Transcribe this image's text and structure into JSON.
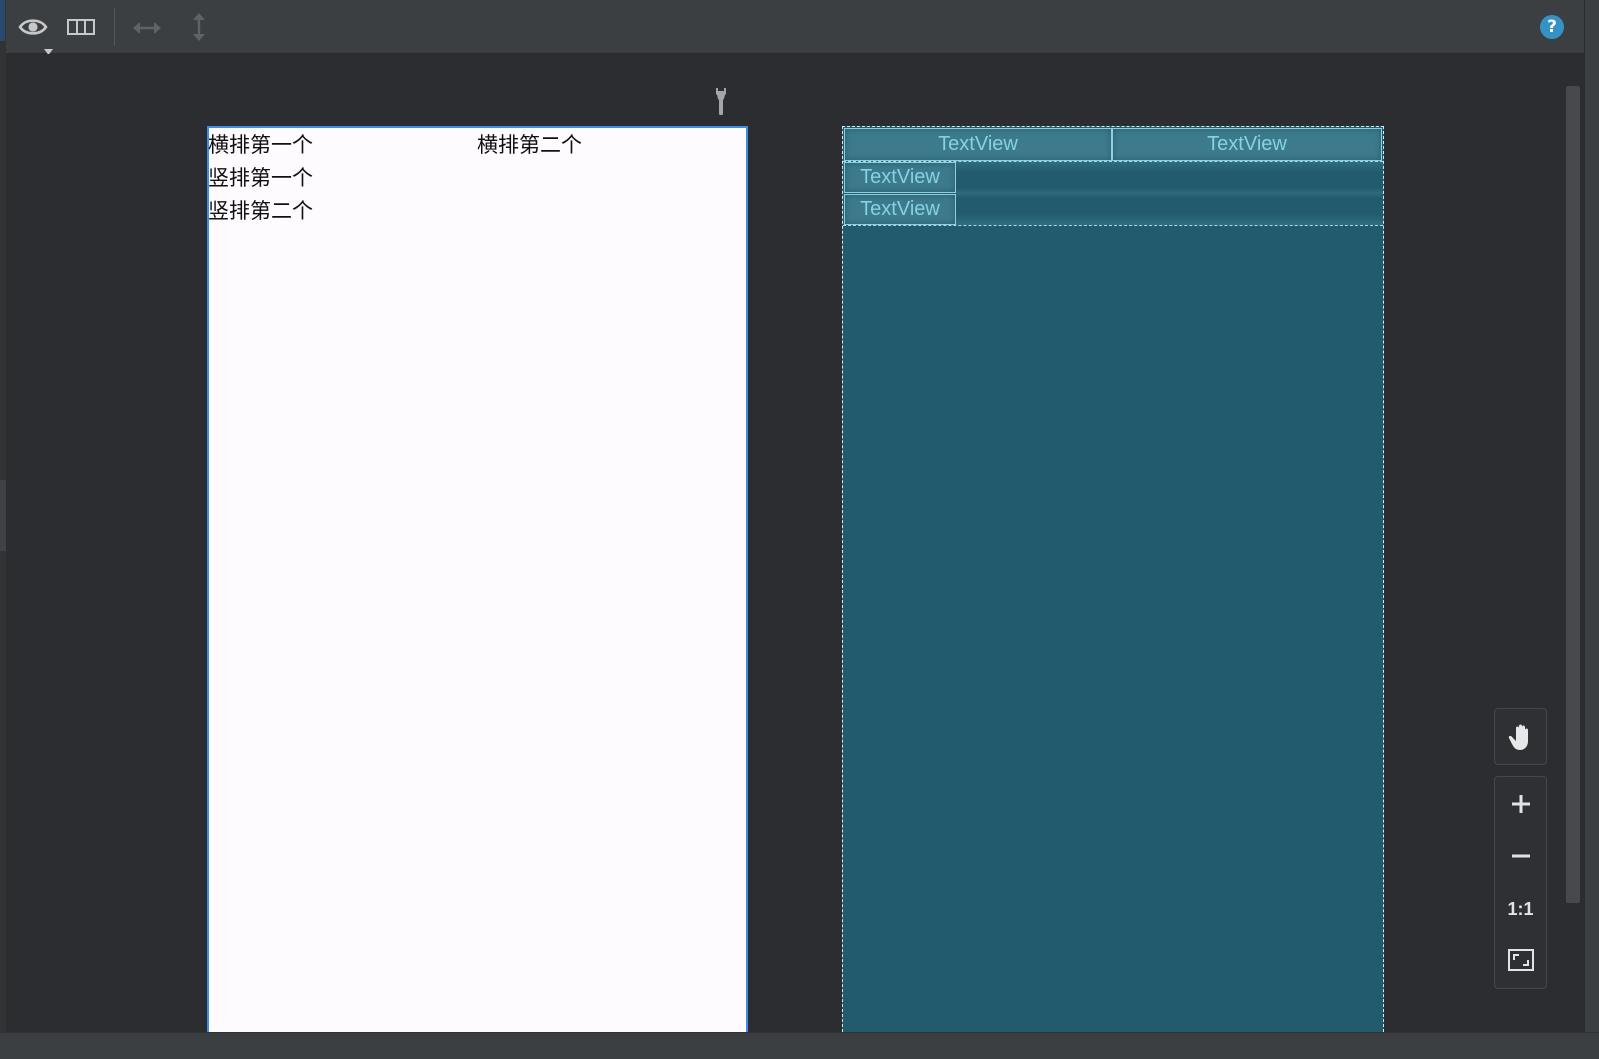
{
  "toolbar": {
    "icons": {
      "eye": "eye-icon",
      "dropdown": "chevron-down-icon",
      "columns": "columns-icon",
      "horizontal": "horizontal-resize-icon",
      "vertical": "vertical-resize-icon",
      "help": "help-icon"
    },
    "help_glyph": "?"
  },
  "canvas": {
    "wrench_icon": "wrench-icon"
  },
  "design": {
    "row": [
      "横排第一个",
      "横排第二个"
    ],
    "column": [
      "竖排第一个",
      "竖排第二个"
    ]
  },
  "blueprint": {
    "row": [
      "TextView",
      "TextView"
    ],
    "column": [
      "TextView",
      "TextView"
    ]
  },
  "zoom": {
    "pan_icon": "hand-icon",
    "zoom_in_icon": "plus-icon",
    "zoom_out_icon": "minus-icon",
    "actual_size_label": "1:1",
    "fit_icon": "fit-screen-icon"
  },
  "colors": {
    "toolbar_bg": "#3c3f42",
    "canvas_bg": "#2c2d30",
    "design_bg": "#fefbfe",
    "design_border": "#3d8ee6",
    "blueprint_bg": "#235b6e",
    "blueprint_cell": "#3c7a8c",
    "blueprint_text": "#84d2e4",
    "help_accent": "#3592c4"
  }
}
